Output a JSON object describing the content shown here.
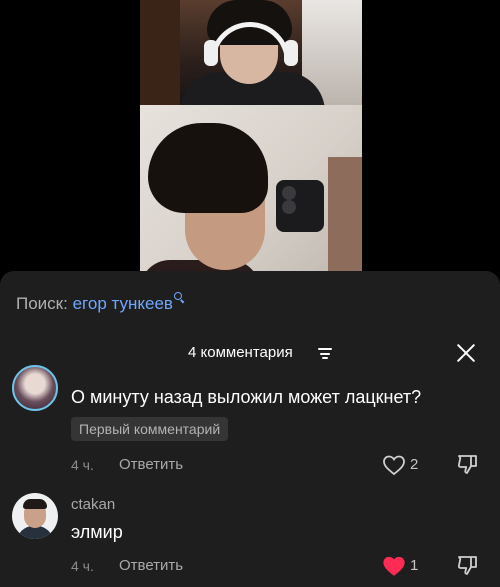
{
  "search": {
    "prefix": "Поиск:",
    "query": "егор тункеев",
    "icon": "search-icon"
  },
  "comments_header": {
    "count_label": "4 комментария",
    "sort_icon": "sort-icon",
    "close_icon": "close-icon"
  },
  "comments": [
    {
      "name": "",
      "text": "О минуту назад выложил может лацкнет?",
      "badge": "Первый комментарий",
      "time": "4 ч.",
      "reply_label": "Ответить",
      "likes": "2",
      "liked": false
    },
    {
      "name": "ctakan",
      "text": "элмир",
      "time": "4 ч.",
      "reply_label": "Ответить",
      "likes": "1",
      "liked": true
    }
  ],
  "colors": {
    "sheet_bg": "#1e1e1e",
    "accent_link": "#6fa7ff",
    "like_active": "#fe2c55"
  }
}
